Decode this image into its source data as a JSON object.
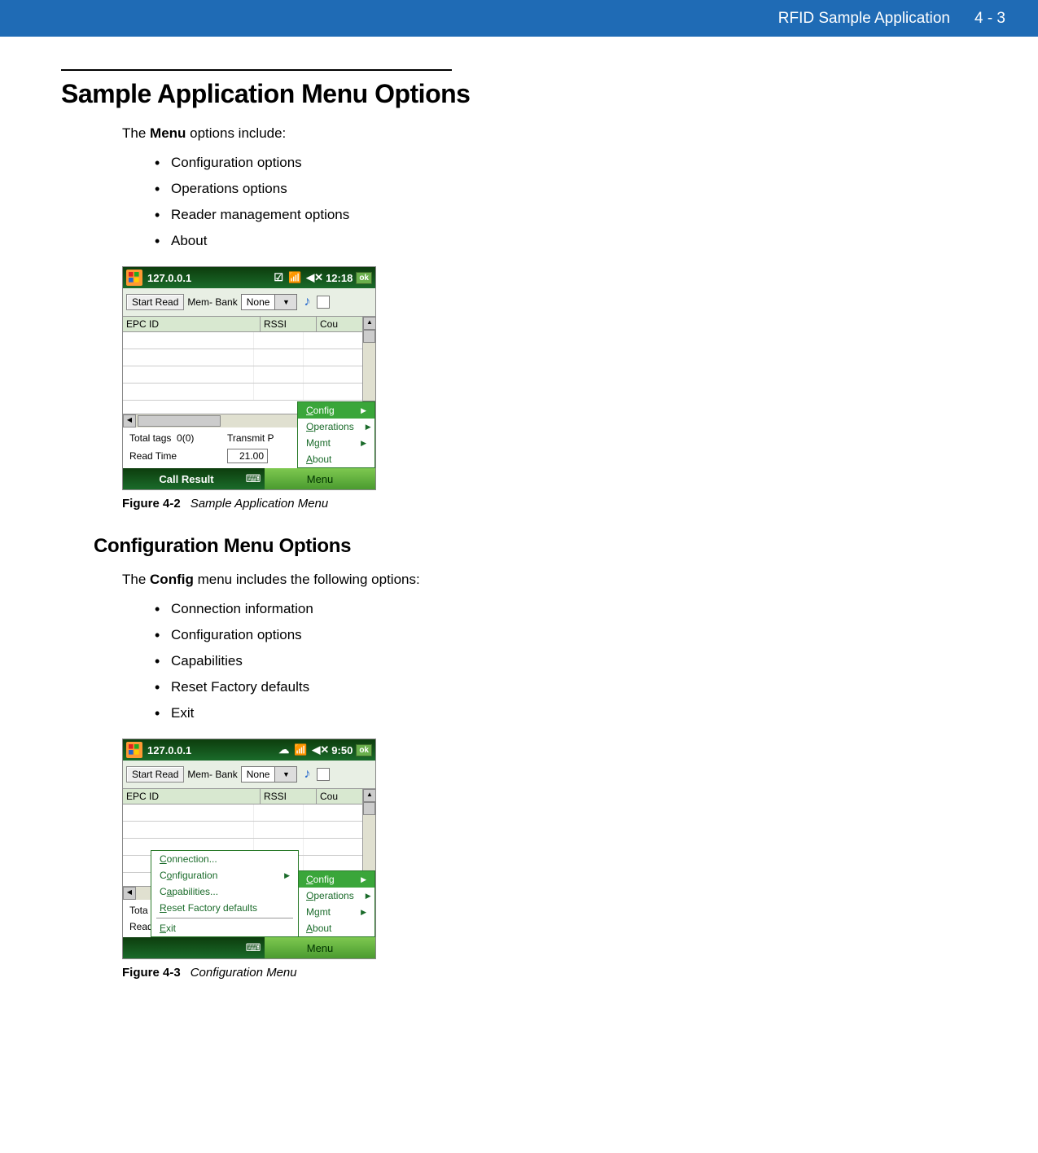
{
  "header": {
    "title": "RFID Sample Application",
    "page": "4 - 3"
  },
  "section1": {
    "heading": "Sample Application Menu Options",
    "intro_pre": "The ",
    "intro_bold": "Menu",
    "intro_post": " options include:",
    "bullets": [
      "Configuration options",
      "Operations options",
      "Reader management options",
      "About"
    ]
  },
  "figure1": {
    "label": "Figure 4-2",
    "caption": "Sample Application Menu"
  },
  "section2": {
    "heading": "Configuration Menu Options",
    "intro_pre": "The ",
    "intro_bold": "Config",
    "intro_post": " menu includes the following options:",
    "bullets": [
      "Connection information",
      "Configuration options",
      "Capabilities",
      "Reset Factory defaults",
      "Exit"
    ]
  },
  "figure2": {
    "label": "Figure 4-3",
    "caption": "Configuration Menu"
  },
  "device_common": {
    "ip": "127.0.0.1",
    "ok": "ok",
    "start_read": "Start Read",
    "membank_label": "Mem- Bank",
    "membank_value": "None",
    "col_epc": "EPC ID",
    "col_rssi": "RSSI",
    "col_cou": "Cou",
    "total_tags_label": "Total tags",
    "total_tags_value": "0(0)",
    "transmit_label": "Transmit P",
    "transmit_value": "21.00",
    "readtime_label": "Read Time",
    "bottom_left": "Call Result",
    "bottom_right": "Menu"
  },
  "device1": {
    "time": "12:18",
    "menu": [
      "Config",
      "Operations",
      "Mgmt",
      "About"
    ]
  },
  "device2": {
    "time": "9:50",
    "total_tags_label_trunc": "Tota",
    "readtime_trunc": "Read",
    "menu_main": [
      "Config",
      "Operations",
      "Mgmt",
      "About"
    ],
    "submenu": {
      "items": [
        "Connection...",
        "Configuration",
        "Capabilities...",
        "Reset Factory defaults",
        "Exit"
      ],
      "with_arrow_index": 1,
      "sep_after_index": 3
    }
  }
}
